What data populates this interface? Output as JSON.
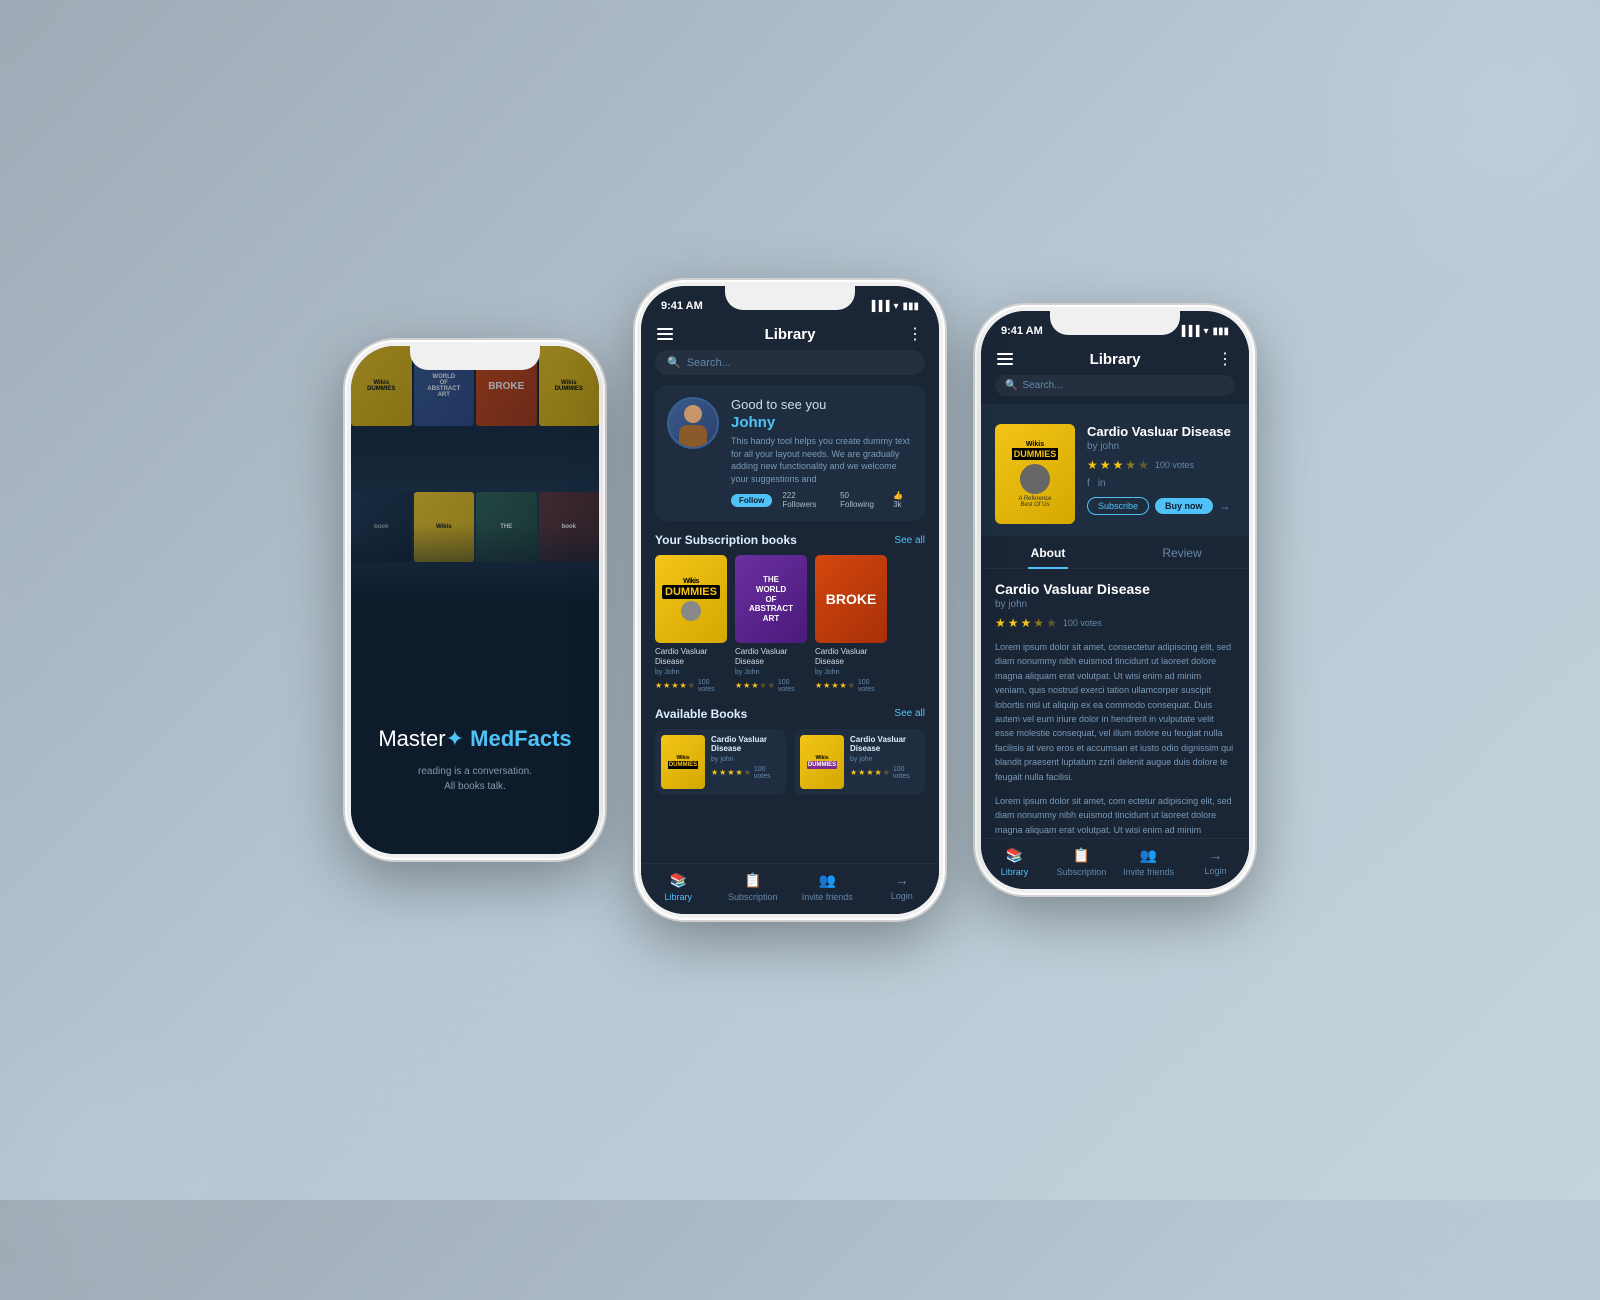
{
  "background": {
    "color": "#b0bec5"
  },
  "app": {
    "name": "Master MedFacts",
    "name_plain": "Master",
    "name_accent": "MedFacts",
    "tagline_line1": "reading is a conversation.",
    "tagline_line2": "All books talk."
  },
  "phone1": {
    "splash": {
      "logo": "Master MedFacts",
      "tagline_1": "reading is a conversation.",
      "tagline_2": "All books talk."
    }
  },
  "phone2": {
    "status_time": "9:41 AM",
    "header_title": "Library",
    "search_placeholder": "Search...",
    "profile": {
      "greeting": "Good to see you",
      "name": "Johny",
      "description": "This handy tool helps you create dummy text for all your layout needs. We are gradually adding new functionality and we welcome your suggestions and",
      "btn_label": "Follow",
      "stat1_label": "222 Followers",
      "stat2_label": "50 Following",
      "stat3": "3k"
    },
    "subscription_section": {
      "title": "Your Subscription books",
      "see_all": "See all",
      "books": [
        {
          "title": "Cardio Vasluar Disease",
          "author": "by John",
          "votes": "100 votes",
          "stars": 4
        },
        {
          "title": "Cardio Vasluar Disease",
          "author": "by John",
          "votes": "100 votes",
          "stars": 3
        },
        {
          "title": "Cardio Vasluar Disease",
          "author": "by John",
          "votes": "100 votes",
          "stars": 4
        }
      ]
    },
    "available_section": {
      "title": "Available Books",
      "see_all": "See all",
      "books": [
        {
          "title": "Cardio Vasluar Disease",
          "author": "by john",
          "votes": "100 votes",
          "stars": 4
        },
        {
          "title": "Cardio Vasluar Disease",
          "author": "by john",
          "votes": "100 votes",
          "stars": 4
        }
      ]
    },
    "nav": {
      "items": [
        {
          "label": "Library",
          "active": true
        },
        {
          "label": "Subscription",
          "active": false
        },
        {
          "label": "Invite friends",
          "active": false
        },
        {
          "label": "Login",
          "active": false
        }
      ]
    }
  },
  "phone3": {
    "status_time": "9:41 AM",
    "header_title": "Library",
    "search_placeholder": "Search...",
    "book": {
      "title": "Cardio Vasluar Disease",
      "author": "by john",
      "votes": "100 votes",
      "stars": 3.5
    },
    "actions": {
      "subscribe_label": "Subscribe",
      "buy_label": "Buy now"
    },
    "tabs": {
      "about_label": "About",
      "review_label": "Review",
      "active": "about"
    },
    "about": {
      "title": "Cardio Vasluar Disease",
      "author": "by john",
      "votes": "100 votes",
      "stars": 3.5,
      "para1": "Lorem ipsum dolor sit amet, consectetur adipiscing elit, sed diam nonummy nibh euismod tincidunt ut laoreet dolore magna aliquam erat volutpat. Ut wisi enim ad minim veniam, quis nostrud exerci tation ullamcorper suscipit lobortis nisl ut aliquip ex ea commodo consequat. Duis autem vel eum iriure dolor in hendrerit in vulputate velit esse molestie consequat, vel illum dolore eu feugiat nulla facilisis at vero eros et accumsan et iusto odio dignissim qui blandit praesent luptatum zzril delenit augue duis dolore te feugait nulla facilisi.",
      "para2": "Lorem ipsum dolor sit amet, com ectetur adipiscing elit, sed diam nonummy nibh euismod tincidunt ut laoreet dolore magna aliquam erat volutpat. Ut wisi enim ad minim veniam, quis nostrud exerci tation ullamcorper suscipit."
    },
    "nav": {
      "items": [
        {
          "label": "Library",
          "active": true
        },
        {
          "label": "Subscription",
          "active": false
        },
        {
          "label": "Invite friends",
          "active": false
        },
        {
          "label": "Login",
          "active": false
        }
      ]
    }
  }
}
